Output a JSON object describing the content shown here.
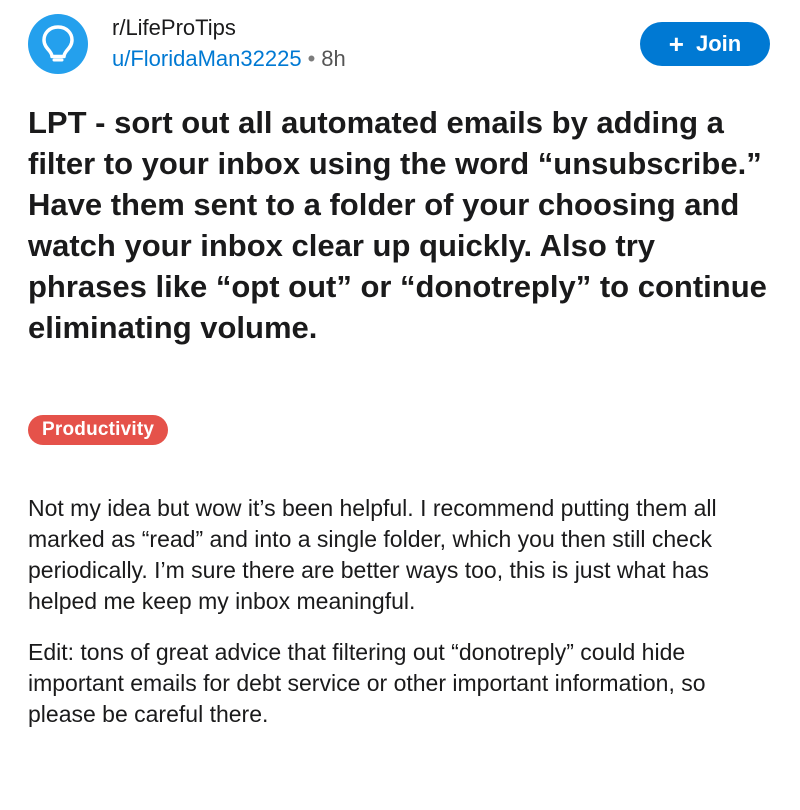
{
  "post": {
    "subreddit": "r/LifeProTips",
    "username": "u/FloridaMan32225",
    "separator": "•",
    "age": "8h",
    "join_label": "Join",
    "title": "LPT - sort out all automated emails by adding a filter to your inbox using the word “unsubscribe.” Have them sent to a folder of your choosing and watch your inbox clear up quickly. Also try phrases like “opt out” or “donotreply” to continue eliminating volume.",
    "flair": "Productivity",
    "paragraphs": [
      "Not my idea but wow it’s been helpful. I recommend putting them all marked as “read” and into a single folder, which you then still check periodically. I’m sure there are better ways too, this is just what has helped me keep my inbox meaningful.",
      "Edit: tons of great advice that filtering out “donotreply” could hide important emails for debt service or other important information, so please be careful there."
    ]
  },
  "icons": {
    "avatar": "lightbulb-icon",
    "join": "plus-icon"
  },
  "colors": {
    "avatar_bg": "#24a0ed",
    "join_bg": "#0079d3",
    "username": "#0079d3",
    "flair_bg": "#e5524a",
    "text": "#1a1a1b"
  }
}
